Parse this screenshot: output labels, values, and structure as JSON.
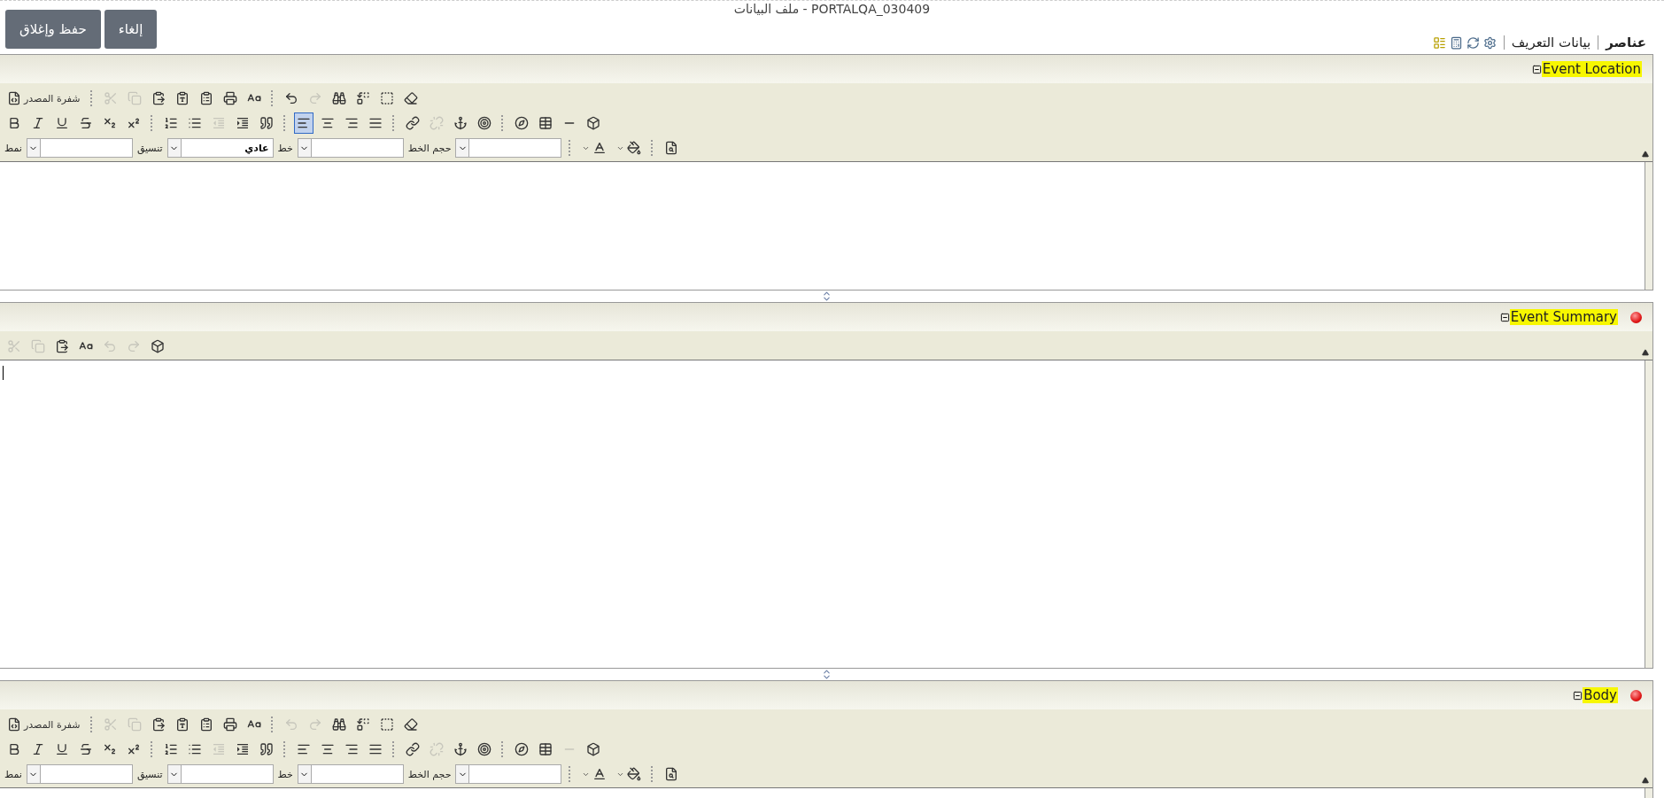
{
  "title": "ملف البيانات - PORTALQA_030409",
  "buttons": [
    {
      "label": "إلغاء"
    },
    {
      "label": "حفظ وإغلاق"
    }
  ],
  "tabs": [
    {
      "label": "عناصر",
      "selected": true
    },
    {
      "label": "بيانات التعريف",
      "selected": false
    }
  ],
  "panels": [
    {
      "title": "Event Location",
      "required": false,
      "focused": false,
      "toolbar_rows": [
        {
          "items": [
            {
              "kind": "source",
              "label": "شفرة المصدر",
              "disabled": false,
              "selected": false
            },
            {
              "kind": "separator"
            },
            {
              "kind": "cut",
              "disabled": true,
              "selected": false
            },
            {
              "kind": "copy",
              "disabled": true,
              "selected": false
            },
            {
              "kind": "paste",
              "disabled": false,
              "selected": false
            },
            {
              "kind": "paste-text",
              "disabled": false,
              "selected": false
            },
            {
              "kind": "paste-word",
              "disabled": false,
              "selected": false
            },
            {
              "kind": "print",
              "disabled": false,
              "selected": false
            },
            {
              "kind": "spellcheck",
              "disabled": false,
              "selected": false
            },
            {
              "kind": "separator"
            },
            {
              "kind": "undo",
              "disabled": false,
              "selected": false
            },
            {
              "kind": "redo",
              "disabled": true,
              "selected": false
            },
            {
              "kind": "find",
              "disabled": false,
              "selected": false
            },
            {
              "kind": "replace",
              "disabled": false,
              "selected": false
            },
            {
              "kind": "select-all",
              "disabled": false,
              "selected": false
            },
            {
              "kind": "remove-format",
              "disabled": false,
              "selected": false
            }
          ]
        },
        {
          "items": [
            {
              "kind": "bold",
              "disabled": false,
              "selected": false
            },
            {
              "kind": "italic",
              "disabled": false,
              "selected": false
            },
            {
              "kind": "underline",
              "disabled": false,
              "selected": false
            },
            {
              "kind": "strike",
              "disabled": false,
              "selected": false
            },
            {
              "kind": "subscript",
              "disabled": false,
              "selected": false
            },
            {
              "kind": "superscript",
              "disabled": false,
              "selected": false
            },
            {
              "kind": "separator"
            },
            {
              "kind": "ordered-list",
              "disabled": false,
              "selected": false
            },
            {
              "kind": "bullet-list",
              "disabled": false,
              "selected": false
            },
            {
              "kind": "outdent",
              "disabled": true,
              "selected": false
            },
            {
              "kind": "indent",
              "disabled": false,
              "selected": false
            },
            {
              "kind": "blockquote",
              "disabled": false,
              "selected": false
            },
            {
              "kind": "separator"
            },
            {
              "kind": "align-left",
              "disabled": false,
              "selected": true
            },
            {
              "kind": "align-center",
              "disabled": false,
              "selected": false
            },
            {
              "kind": "align-right",
              "disabled": false,
              "selected": false
            },
            {
              "kind": "align-justify",
              "disabled": false,
              "selected": false
            },
            {
              "kind": "separator"
            },
            {
              "kind": "link",
              "disabled": false,
              "selected": false
            },
            {
              "kind": "unlink",
              "disabled": true,
              "selected": false
            },
            {
              "kind": "anchor",
              "disabled": false,
              "selected": false
            },
            {
              "kind": "target",
              "disabled": false,
              "selected": false
            },
            {
              "kind": "separator"
            },
            {
              "kind": "flash",
              "disabled": false,
              "selected": false
            },
            {
              "kind": "table",
              "disabled": false,
              "selected": false
            },
            {
              "kind": "rule",
              "disabled": false,
              "selected": false
            },
            {
              "kind": "special-char",
              "disabled": false,
              "selected": false
            }
          ]
        },
        {
          "items": [
            {
              "kind": "preview",
              "disabled": false,
              "selected": false
            },
            {
              "kind": "separator"
            },
            {
              "kind": "bg-color",
              "disabled": false,
              "selected": false
            },
            {
              "kind": "text-color",
              "disabled": false,
              "selected": false
            },
            {
              "kind": "separator"
            },
            {
              "kind": "select"
            },
            {
              "kind": "label",
              "label": "حجم الخط"
            },
            {
              "kind": "select"
            },
            {
              "kind": "label",
              "label": "خط"
            },
            {
              "kind": "select",
              "value": "عادي"
            },
            {
              "kind": "label",
              "label": "تنسيق"
            },
            {
              "kind": "select"
            },
            {
              "kind": "label",
              "label": "نمط"
            }
          ]
        }
      ]
    },
    {
      "title": "Event Summary",
      "required": true,
      "focused": true,
      "toolbar_rows": [
        {
          "items": [
            {
              "kind": "cut",
              "disabled": true,
              "selected": false
            },
            {
              "kind": "copy",
              "disabled": true,
              "selected": false
            },
            {
              "kind": "paste",
              "disabled": false,
              "selected": false
            },
            {
              "kind": "spellcheck",
              "disabled": false,
              "selected": false
            },
            {
              "kind": "undo",
              "disabled": true,
              "selected": false
            },
            {
              "kind": "redo",
              "disabled": true,
              "selected": false
            },
            {
              "kind": "special-char",
              "disabled": false,
              "selected": false
            }
          ]
        }
      ]
    },
    {
      "title": "Body",
      "required": true,
      "focused": false,
      "toolbar_rows": [
        {
          "items": [
            {
              "kind": "source",
              "label": "شفرة المصدر",
              "disabled": false,
              "selected": false
            },
            {
              "kind": "separator"
            },
            {
              "kind": "cut",
              "disabled": true,
              "selected": false
            },
            {
              "kind": "copy",
              "disabled": true,
              "selected": false
            },
            {
              "kind": "paste",
              "disabled": false,
              "selected": false
            },
            {
              "kind": "paste-text",
              "disabled": false,
              "selected": false
            },
            {
              "kind": "paste-word",
              "disabled": false,
              "selected": false
            },
            {
              "kind": "print",
              "disabled": false,
              "selected": false
            },
            {
              "kind": "spellcheck",
              "disabled": false,
              "selected": false
            },
            {
              "kind": "separator"
            },
            {
              "kind": "undo",
              "disabled": true,
              "selected": false
            },
            {
              "kind": "redo",
              "disabled": true,
              "selected": false
            },
            {
              "kind": "find",
              "disabled": false,
              "selected": false
            },
            {
              "kind": "replace",
              "disabled": false,
              "selected": false
            },
            {
              "kind": "select-all",
              "disabled": false,
              "selected": false
            },
            {
              "kind": "remove-format",
              "disabled": false,
              "selected": false
            }
          ]
        },
        {
          "items": [
            {
              "kind": "bold",
              "disabled": false,
              "selected": false
            },
            {
              "kind": "italic",
              "disabled": false,
              "selected": false
            },
            {
              "kind": "underline",
              "disabled": false,
              "selected": false
            },
            {
              "kind": "strike",
              "disabled": false,
              "selected": false
            },
            {
              "kind": "subscript",
              "disabled": false,
              "selected": false
            },
            {
              "kind": "superscript",
              "disabled": false,
              "selected": false
            },
            {
              "kind": "separator"
            },
            {
              "kind": "ordered-list",
              "disabled": false,
              "selected": false
            },
            {
              "kind": "bullet-list",
              "disabled": false,
              "selected": false
            },
            {
              "kind": "outdent",
              "disabled": true,
              "selected": false
            },
            {
              "kind": "indent",
              "disabled": false,
              "selected": false
            },
            {
              "kind": "blockquote",
              "disabled": false,
              "selected": false
            },
            {
              "kind": "separator"
            },
            {
              "kind": "align-left",
              "disabled": false,
              "selected": false
            },
            {
              "kind": "align-center",
              "disabled": false,
              "selected": false
            },
            {
              "kind": "align-right",
              "disabled": false,
              "selected": false
            },
            {
              "kind": "align-justify",
              "disabled": false,
              "selected": false
            },
            {
              "kind": "separator"
            },
            {
              "kind": "link",
              "disabled": false,
              "selected": false
            },
            {
              "kind": "unlink",
              "disabled": true,
              "selected": false
            },
            {
              "kind": "anchor",
              "disabled": false,
              "selected": false
            },
            {
              "kind": "target",
              "disabled": false,
              "selected": false
            },
            {
              "kind": "separator"
            },
            {
              "kind": "flash",
              "disabled": false,
              "selected": false
            },
            {
              "kind": "table",
              "disabled": false,
              "selected": false
            },
            {
              "kind": "rule",
              "disabled": true,
              "selected": false
            },
            {
              "kind": "special-char",
              "disabled": false,
              "selected": false
            }
          ]
        },
        {
          "items": [
            {
              "kind": "preview",
              "disabled": false,
              "selected": false
            },
            {
              "kind": "separator"
            },
            {
              "kind": "bg-color",
              "disabled": false,
              "selected": false
            },
            {
              "kind": "text-color",
              "disabled": false,
              "selected": false
            },
            {
              "kind": "separator"
            },
            {
              "kind": "select"
            },
            {
              "kind": "label",
              "label": "حجم الخط"
            },
            {
              "kind": "select"
            },
            {
              "kind": "label",
              "label": "خط"
            },
            {
              "kind": "select"
            },
            {
              "kind": "label",
              "label": "تنسيق"
            },
            {
              "kind": "select"
            },
            {
              "kind": "label",
              "label": "نمط"
            }
          ]
        }
      ]
    }
  ]
}
